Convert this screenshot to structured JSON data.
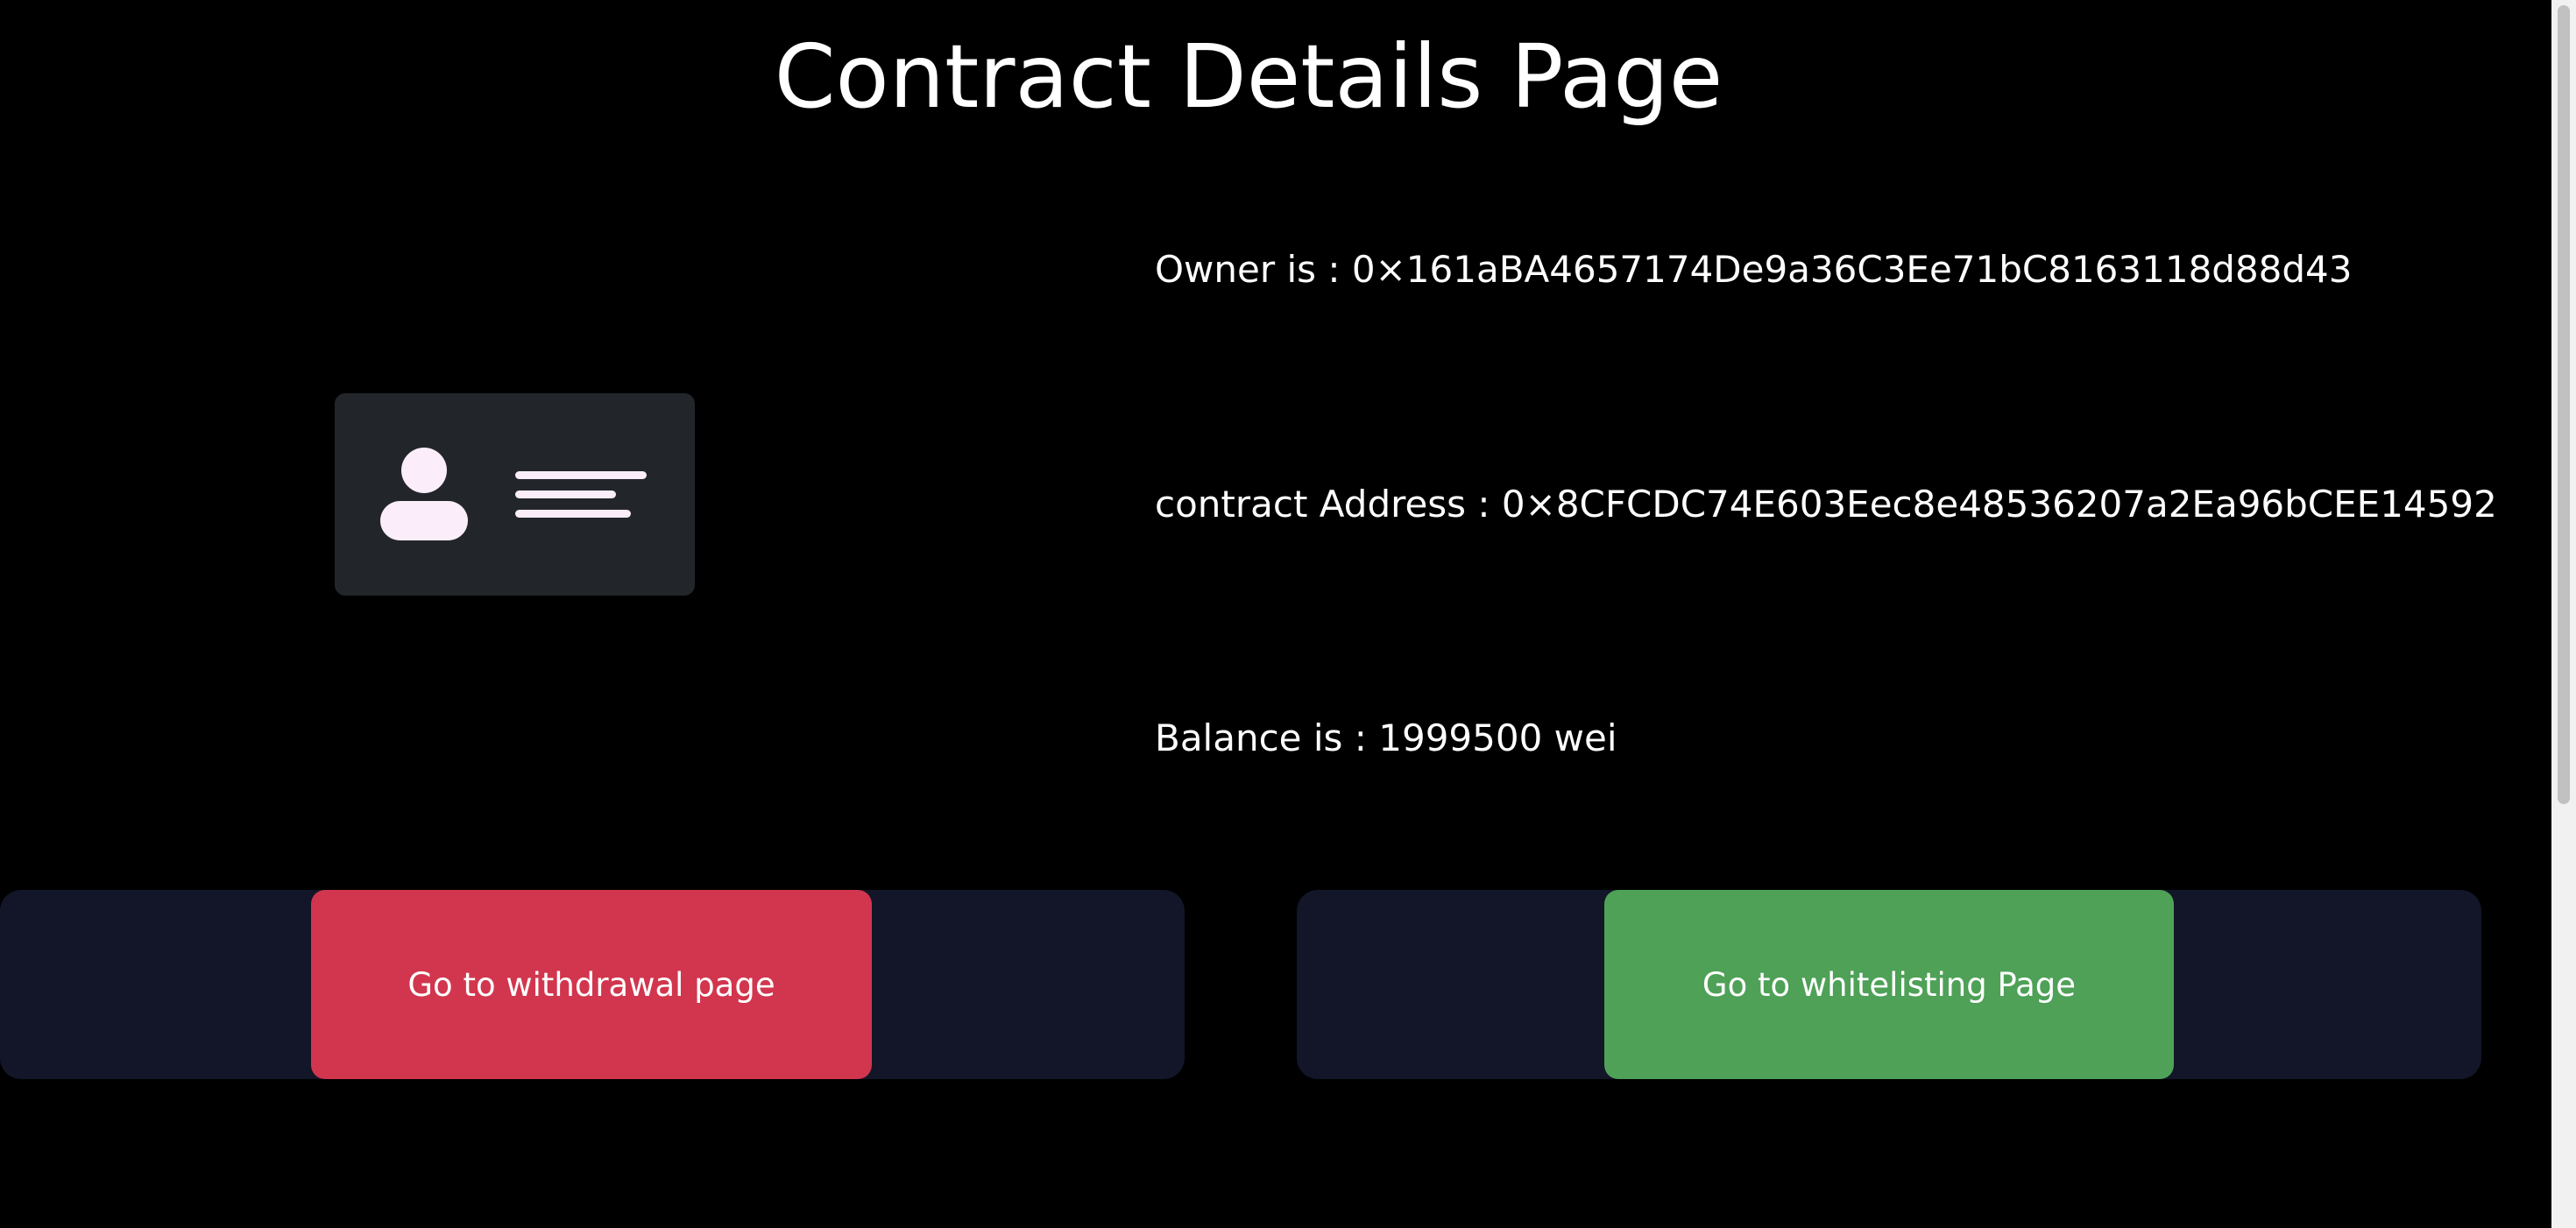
{
  "page": {
    "title": "Contract Details Page"
  },
  "details": {
    "owner": "Owner is : 0×161aBA4657174De9a36C3Ee71bC8163118d88d43",
    "contract_address": "contract Address : 0×8CFCDC74E603Eec8e48536207a2Ea96bCEE14592",
    "balance": "Balance is : 1999500 wei"
  },
  "illustration": {
    "icon": "id-card-icon"
  },
  "actions": {
    "withdrawal_label": "Go to withdrawal page",
    "whitelisting_label": "Go to whitelisting Page"
  },
  "colors": {
    "background": "#000000",
    "card": "#22262b",
    "panel": "#121628",
    "withdrawal_button": "#d1364e",
    "whitelisting_button": "#4ea157",
    "icon_fill": "#fbeefa"
  }
}
